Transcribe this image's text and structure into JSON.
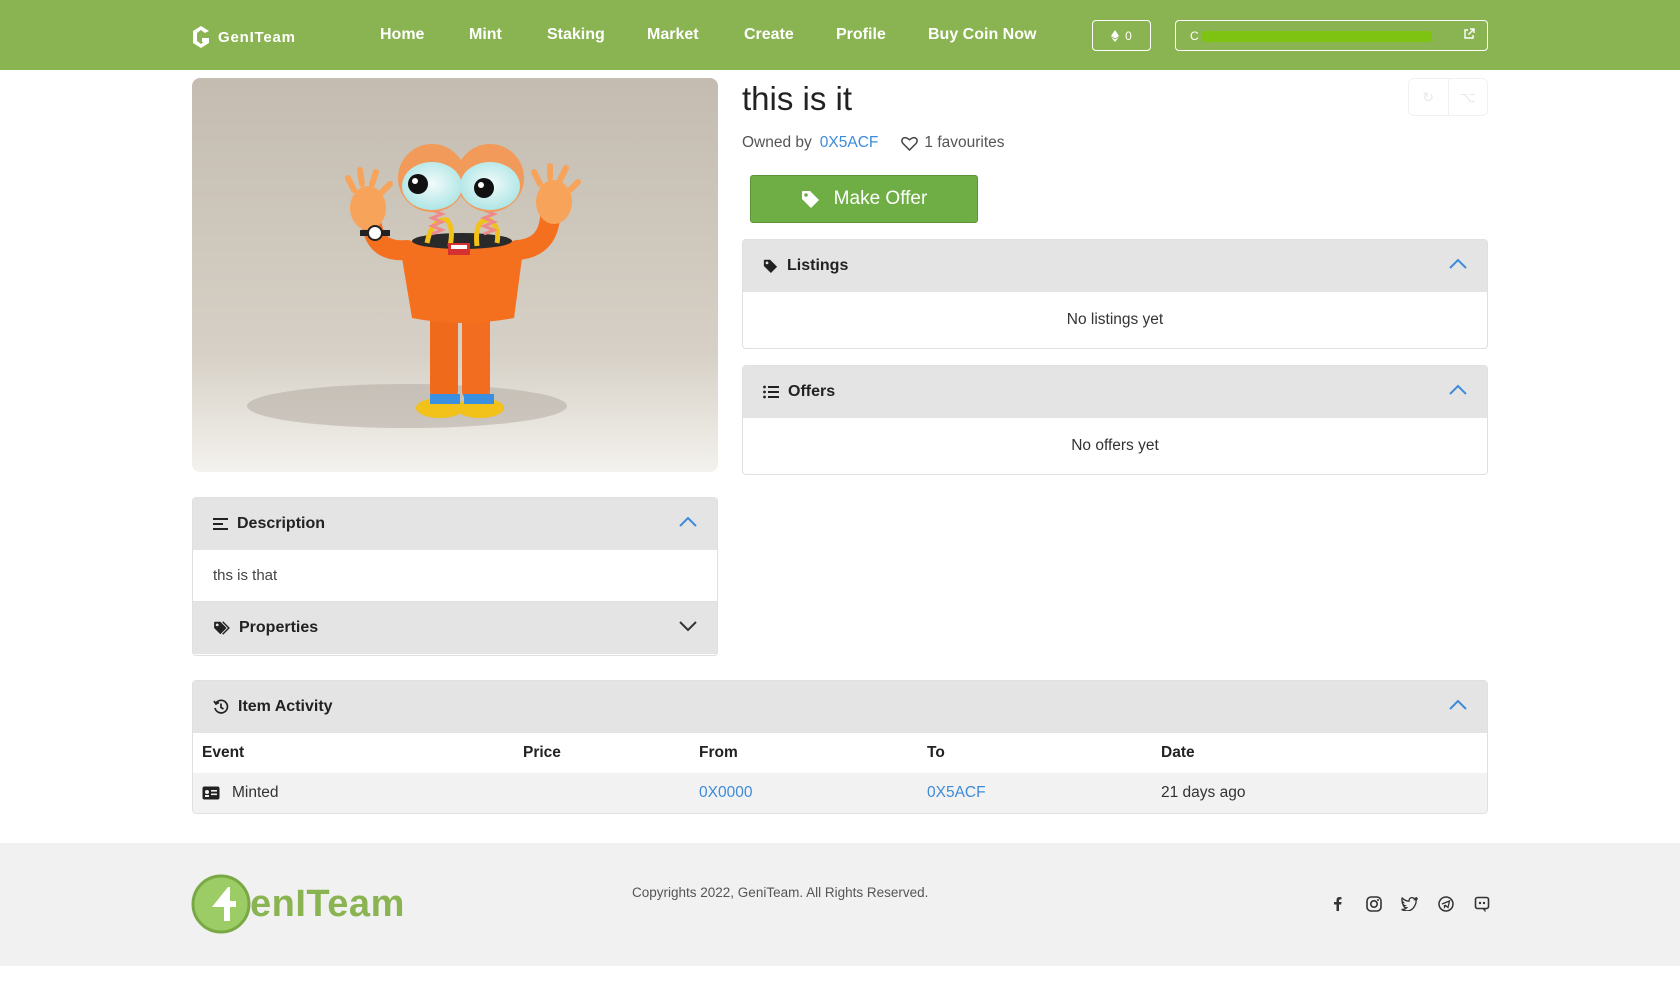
{
  "navbar": {
    "brand": "GenITeam",
    "links": [
      "Home",
      "Mint",
      "Staking",
      "Market",
      "Create",
      "Profile",
      "Buy Coin Now"
    ],
    "coin_balance": "0",
    "wallet_address_visible": "C"
  },
  "item": {
    "title": "this is it",
    "owned_by_label": "Owned by",
    "owner": "0X5ACF",
    "favourites": "1 favourites",
    "make_offer_label": "Make Offer"
  },
  "listings": {
    "title": "Listings",
    "empty_text": "No listings yet"
  },
  "offers": {
    "title": "Offers",
    "empty_text": "No offers yet"
  },
  "description": {
    "title": "Description",
    "text": "ths is that"
  },
  "properties": {
    "title": "Properties"
  },
  "activity": {
    "title": "Item Activity",
    "columns": [
      "Event",
      "Price",
      "From",
      "To",
      "Date"
    ],
    "rows": [
      {
        "event": "Minted",
        "price": "",
        "from": "0X0000",
        "to": "0X5ACF",
        "date": "21 days ago"
      }
    ]
  },
  "footer": {
    "logo_text": "enITeam",
    "copyright": "Copyrights 2022, GeniTeam. All Rights Reserved.",
    "socials": [
      "facebook-icon",
      "instagram-icon",
      "twitter-icon",
      "telegram-icon",
      "discord-icon"
    ]
  },
  "colors": {
    "brand_green": "#8ab452",
    "button_green": "#6fae45",
    "link_blue": "#3d8bd9",
    "panel_header": "#e4e4e4"
  }
}
